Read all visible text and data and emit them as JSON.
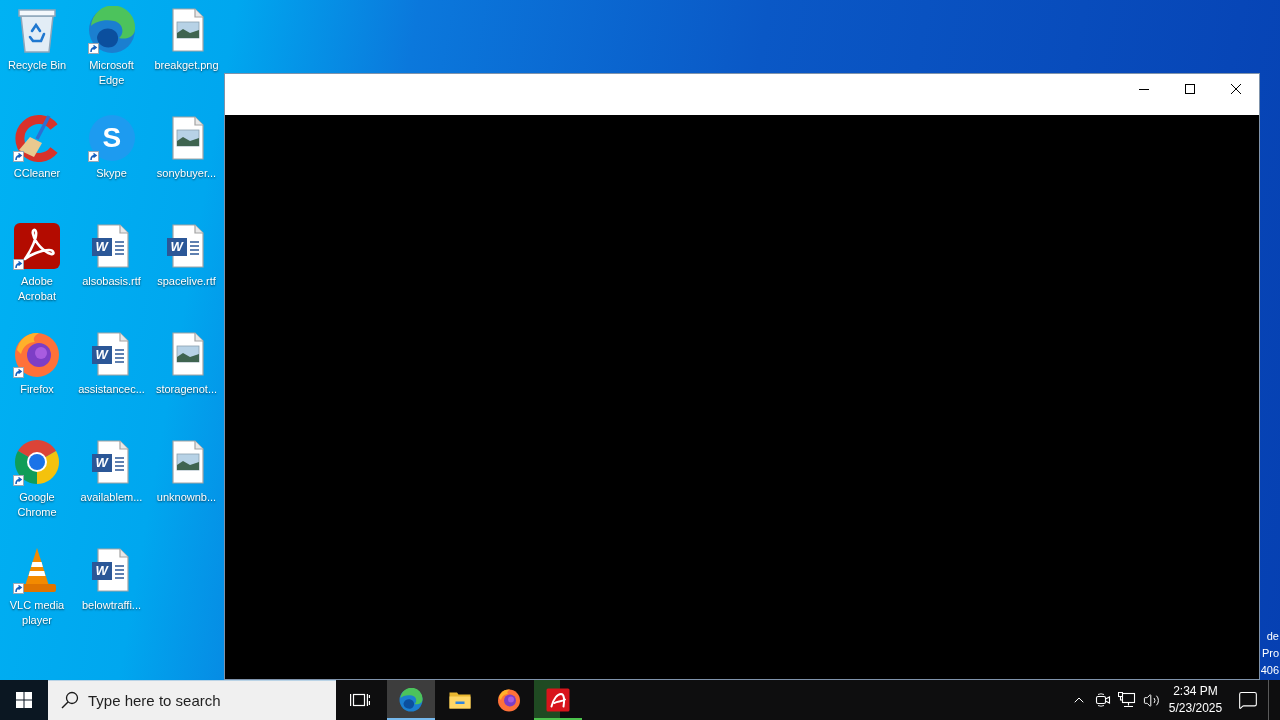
{
  "desktop_icons": [
    {
      "label": "Recycle Bin",
      "kind": "recycle-bin",
      "shortcut": false
    },
    {
      "label": "CCleaner",
      "kind": "ccleaner",
      "shortcut": true
    },
    {
      "label": "Adobe Acrobat",
      "kind": "acrobat",
      "shortcut": true
    },
    {
      "label": "Firefox",
      "kind": "firefox",
      "shortcut": true
    },
    {
      "label": "Google Chrome",
      "kind": "chrome",
      "shortcut": true
    },
    {
      "label": "VLC media player",
      "kind": "vlc",
      "shortcut": true
    },
    {
      "label": "Microsoft Edge",
      "kind": "edge",
      "shortcut": true
    },
    {
      "label": "Skype",
      "kind": "skype",
      "shortcut": true,
      "logo_text": "S"
    },
    {
      "label": "alsobasis.rtf",
      "kind": "word-document",
      "shortcut": false,
      "logo_text": "W"
    },
    {
      "label": "assistancec...",
      "kind": "word-document",
      "shortcut": false,
      "logo_text": "W"
    },
    {
      "label": "availablem...",
      "kind": "word-document",
      "shortcut": false,
      "logo_text": "W"
    },
    {
      "label": "belowtraffi...",
      "kind": "word-document",
      "shortcut": false,
      "logo_text": "W"
    },
    {
      "label": "breakget.png",
      "kind": "image-file",
      "shortcut": false
    },
    {
      "label": "sonybuyer...",
      "kind": "image-file",
      "shortcut": false
    },
    {
      "label": "spacelive.rtf",
      "kind": "word-document",
      "shortcut": false,
      "logo_text": "W"
    },
    {
      "label": "storagenot...",
      "kind": "image-file",
      "shortcut": false
    },
    {
      "label": "unknownb...",
      "kind": "image-file",
      "shortcut": false
    }
  ],
  "window": {
    "maximized": false
  },
  "desktop_corner_text": [
    "de",
    "Pro",
    "406"
  ],
  "taskbar": {
    "search": {
      "placeholder": "Type here to search"
    },
    "apps": [
      {
        "kind": "edge",
        "selected": true,
        "running": true
      },
      {
        "kind": "file-explorer",
        "selected": false,
        "running": false
      },
      {
        "kind": "firefox",
        "selected": false,
        "running": false
      },
      {
        "kind": "avira",
        "selected": false,
        "running": true,
        "level": 0.55
      }
    ],
    "clock": {
      "time": "2:34 PM",
      "date": "5/23/2025"
    }
  }
}
